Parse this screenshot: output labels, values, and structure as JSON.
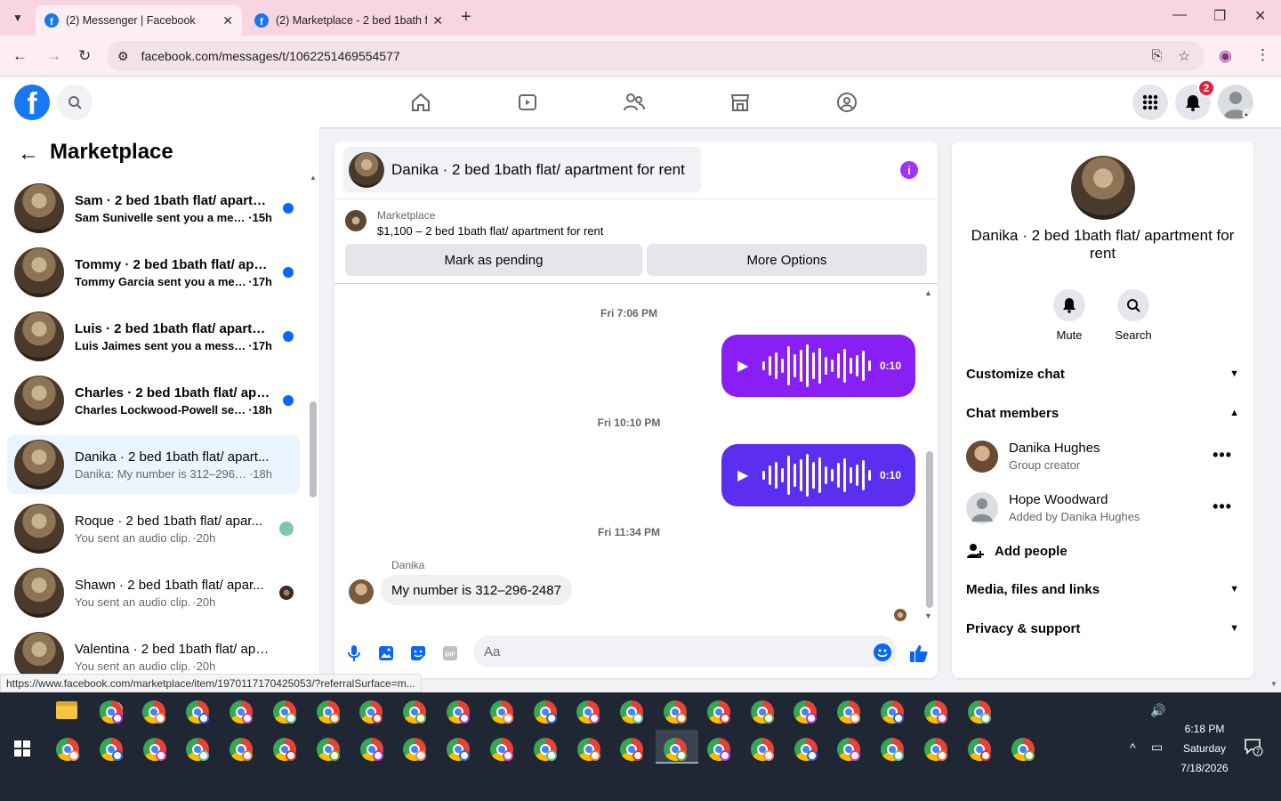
{
  "browser": {
    "tabs": [
      {
        "title": "(2) Messenger | Facebook",
        "active": true
      },
      {
        "title": "(2) Marketplace - 2 bed 1bath f",
        "active": false
      }
    ],
    "url": "facebook.com/messages/t/1062251469554577",
    "status_url": "https://www.facebook.com/marketplace/item/1970117170425053/?referralSurface=m..."
  },
  "fb": {
    "notifications_count": "2",
    "brand_color": "#1877f2"
  },
  "left": {
    "title": "Marketplace",
    "conversations": [
      {
        "name": "Sam · 2 bed 1bath flat/ apartm...",
        "snippet": "Sam Sunivelle sent you a mess...",
        "time": "·15h",
        "unread": true
      },
      {
        "name": "Tommy · 2 bed 1bath flat/ apar...",
        "snippet": "Tommy Garcia sent you a mess...",
        "time": "·17h",
        "unread": true
      },
      {
        "name": "Luis · 2 bed 1bath flat/ apartm...",
        "snippet": "Luis Jaimes sent you a messag...",
        "time": "·17h",
        "unread": true
      },
      {
        "name": "Charles · 2 bed 1bath flat/ apar...",
        "snippet": "Charles Lockwood-Powell sent ...",
        "time": "·18h",
        "unread": true
      },
      {
        "name": "Danika · 2 bed 1bath flat/ apart...",
        "snippet": "Danika: My number is 312–296-2...",
        "time": " ·18h",
        "unread": false,
        "selected": true
      },
      {
        "name": "Roque · 2 bed 1bath flat/ apar...",
        "snippet": "You sent an audio clip.",
        "time": "·20h",
        "unread": false
      },
      {
        "name": "Shawn · 2 bed 1bath flat/ apar...",
        "snippet": "You sent an audio clip.",
        "time": "·20h",
        "unread": false
      },
      {
        "name": "Valentina · 2 bed 1bath flat/ apa...",
        "snippet": "You sent an audio clip.",
        "time": "·20h",
        "unread": false
      }
    ]
  },
  "chat": {
    "title": "Danika · 2 bed 1bath flat/ apartment for rent",
    "marketplace_label": "Marketplace",
    "listing": "$1,100 – 2 bed 1bath flat/ apartment for rent",
    "mark_pending": "Mark as pending",
    "more_options": "More Options",
    "messages": [
      {
        "timestamp": "Fri 7:06 PM",
        "duration": "0:10",
        "color": "#8a1ff5"
      },
      {
        "timestamp": "Fri 10:10 PM",
        "duration": "0:10",
        "color": "#5b2ef0"
      },
      {
        "timestamp": "Fri 11:34 PM"
      }
    ],
    "incoming_sender": "Danika",
    "incoming_text": "My number is 312–296-2487",
    "composer_placeholder": "Aa"
  },
  "right": {
    "title": "Danika · 2 bed 1bath flat/ apartment for rent",
    "mute_label": "Mute",
    "search_label": "Search",
    "customize_chat": "Customize chat",
    "chat_members": "Chat members",
    "members": [
      {
        "name": "Danika Hughes",
        "role": "Group creator"
      },
      {
        "name": "Hope Woodward",
        "role": "Added by Danika Hughes"
      }
    ],
    "add_people": "Add people",
    "media": "Media, files and links",
    "privacy": "Privacy & support"
  },
  "taskbar": {
    "time": "6:18 PM",
    "day": "Saturday",
    "date": "7/18/2026",
    "notification_count": "7"
  }
}
